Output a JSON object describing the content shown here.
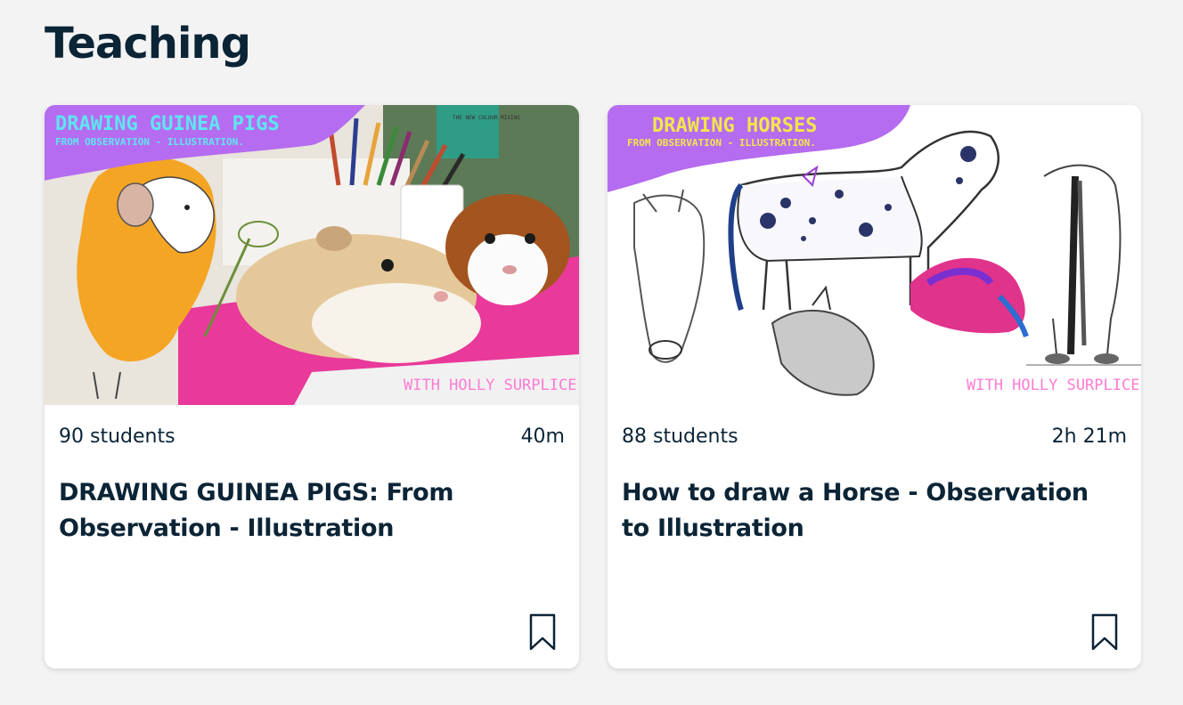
{
  "section": {
    "title": "Teaching"
  },
  "courses": [
    {
      "thumbnail": {
        "headline": "DRAWING GUINEA PIGS",
        "subline": "FROM OBSERVATION - ILLUSTRATION.",
        "credit": "WITH HOLLY SURPLICE",
        "book_text": "THE NEW COLOUR MIXING",
        "banner_color": "#b56cf0",
        "headline_color": "#5ee6f0",
        "credit_color": "#ff7bd3"
      },
      "students": "90 students",
      "duration": "40m",
      "title": "DRAWING GUINEA PIGS: From Observation - Illustration",
      "bookmark_icon": "bookmark-icon"
    },
    {
      "thumbnail": {
        "headline": "DRAWING HORSES",
        "subline": "FROM OBSERVATION - ILLUSTRATION.",
        "credit": "WITH HOLLY SURPLICE",
        "banner_color": "#b56cf0",
        "headline_color": "#f3e64a",
        "credit_color": "#ff7bd3"
      },
      "students": "88 students",
      "duration": "2h 21m",
      "title": "How to draw a Horse - Observation to Illustration",
      "bookmark_icon": "bookmark-icon"
    }
  ]
}
